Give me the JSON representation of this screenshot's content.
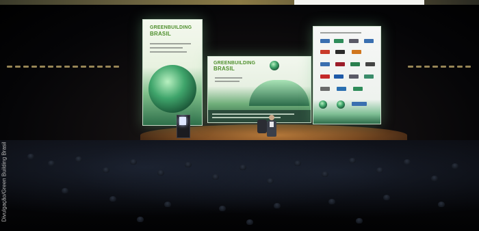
{
  "photo": {
    "credit": "Divulgação/Green Building Brasil",
    "banner_left": {
      "brand_line1": "GREENBUILDING",
      "brand_line2": "BRASIL"
    },
    "banner_center": {
      "brand_line1": "GREENBUILDING",
      "brand_line2": "BRASIL"
    }
  },
  "colors": {
    "brand_green": "#4e8f2c",
    "stage_wood": "#b7793a"
  }
}
